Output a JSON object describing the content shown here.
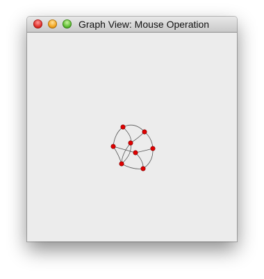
{
  "window": {
    "title": "Graph View: Mouse Operation"
  },
  "graph": {
    "node_color": "#e00000",
    "edge_color": "#555555",
    "node_count": 9
  }
}
